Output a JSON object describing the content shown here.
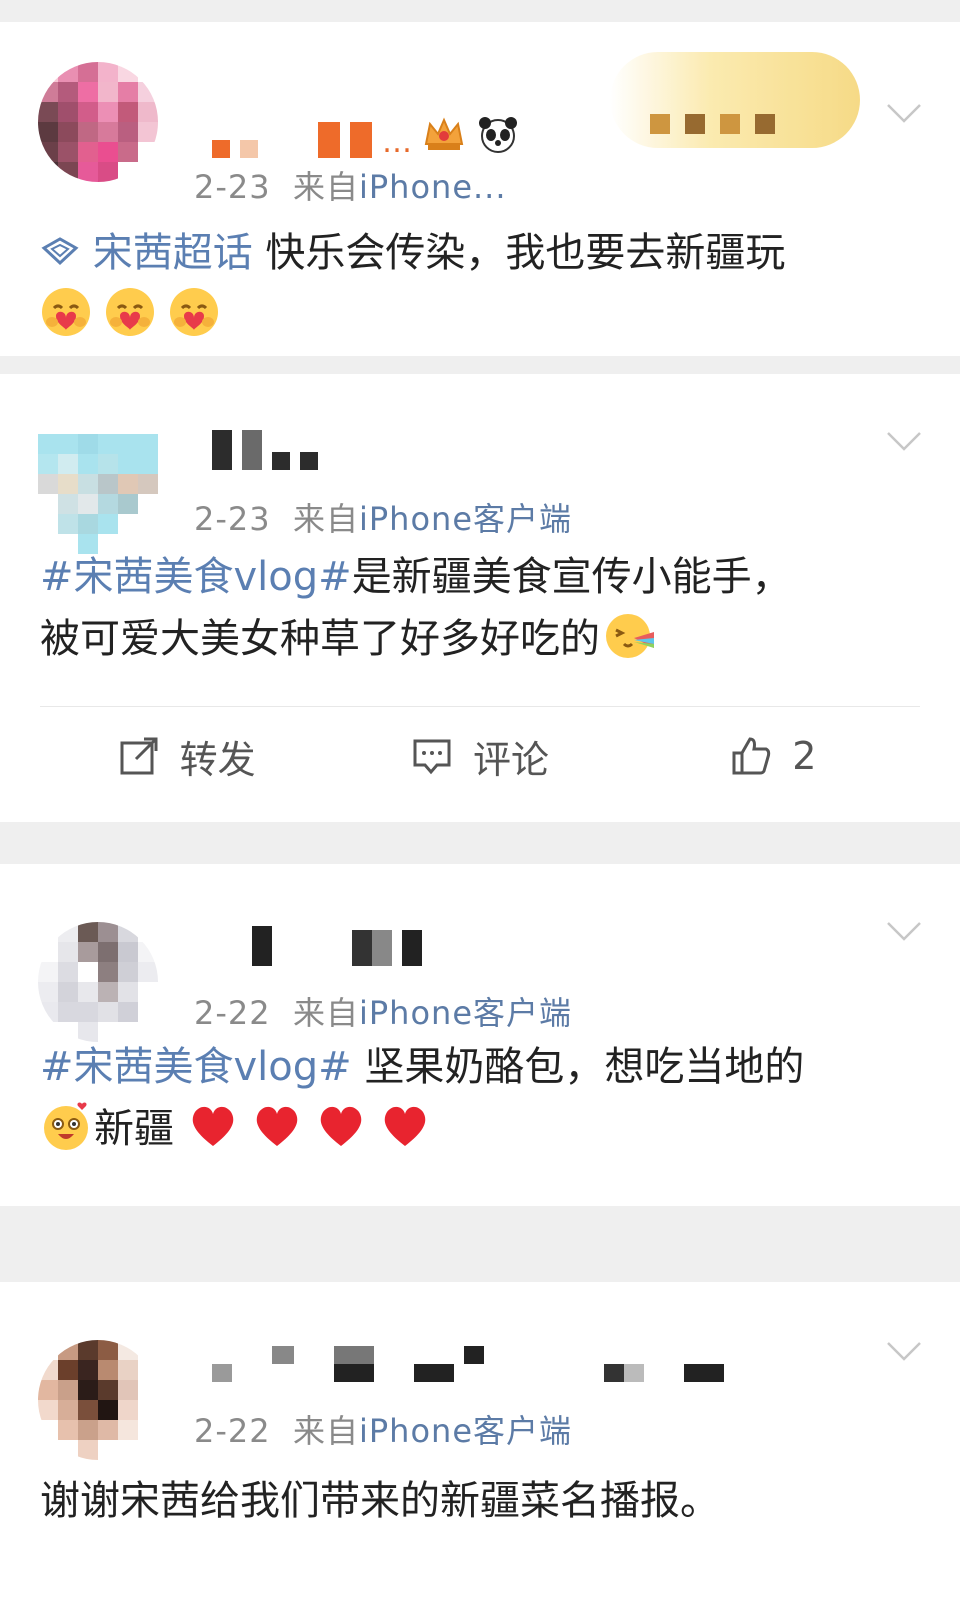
{
  "posts": [
    {
      "date": "2-23",
      "source_prefix": "来自",
      "source": "iPhone...",
      "name_suffix": "…",
      "topic": "宋茜超话",
      "text": " 快乐会传染，我也要去新疆玩",
      "emojis": [
        "hug-heart-emoji",
        "hug-heart-emoji",
        "hug-heart-emoji"
      ]
    },
    {
      "date": "2-23",
      "source_prefix": "来自",
      "source": "iPhone客户端",
      "hashtag": "#宋茜美食vlog#",
      "text_line1": "是新疆美食宣传小能手，",
      "text_line2": "被可爱大美女种草了好多好吃的",
      "emojis": [
        "rainbow-vomit-emoji"
      ],
      "actions": {
        "repost": "转发",
        "comment": "评论",
        "like_count": "2"
      }
    },
    {
      "date": "2-22",
      "source_prefix": "来自",
      "source": "iPhone客户端",
      "hashtag": "#宋茜美食vlog#",
      "text_line1": " 坚果奶酪包，想吃当地的",
      "text_line2": "新疆",
      "emojis": [
        "excited-face-emoji",
        "heart-emoji",
        "heart-emoji",
        "heart-emoji",
        "heart-emoji"
      ]
    },
    {
      "date": "2-22",
      "source_prefix": "来自",
      "source": "iPhone客户端",
      "text": "谢谢宋茜给我们带来的新疆菜名播报。"
    }
  ],
  "colors": {
    "link": "#5b7fb2",
    "meta": "#8a8a8a",
    "separator": "#efefef"
  }
}
